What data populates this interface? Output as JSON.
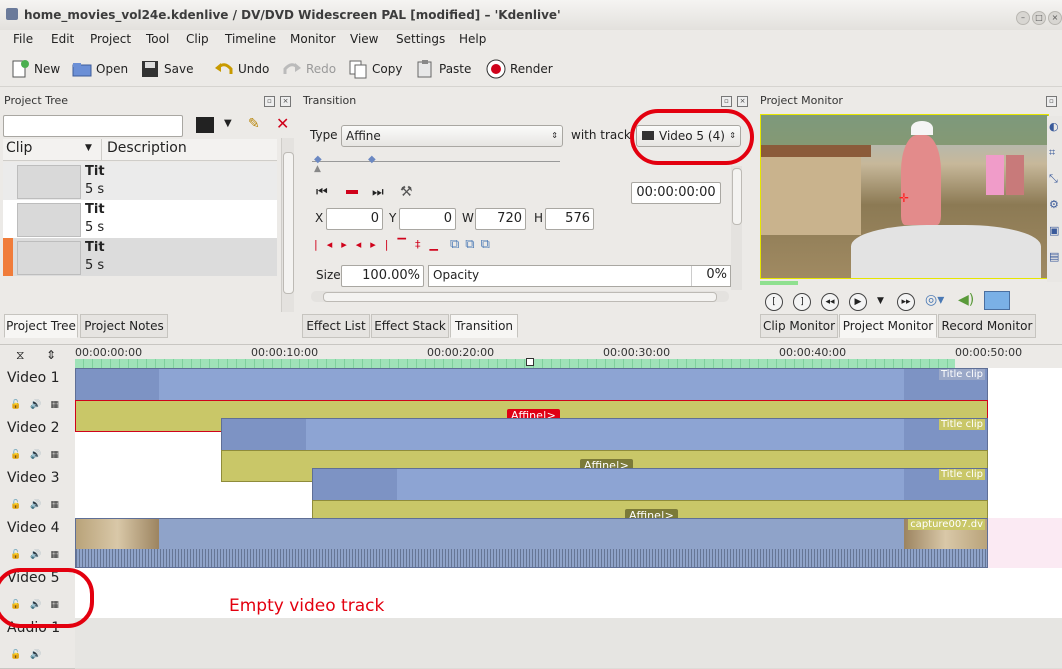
{
  "window": {
    "title": "home_movies_vol24e.kdenlive / DV/DVD Widescreen PAL [modified] – 'Kdenlive'"
  },
  "menu": [
    "File",
    "Edit",
    "Project",
    "Tool",
    "Clip",
    "Timeline",
    "Monitor",
    "View",
    "Settings",
    "Help"
  ],
  "toolbar": {
    "new": "New",
    "open": "Open",
    "save": "Save",
    "undo": "Undo",
    "redo": "Redo",
    "copy": "Copy",
    "paste": "Paste",
    "render": "Render"
  },
  "project_tree": {
    "title": "Project Tree",
    "col_clip": "Clip",
    "col_description": "Description",
    "items": [
      {
        "name": "Tit",
        "duration": "5 s"
      },
      {
        "name": "Tit",
        "duration": "5 s"
      },
      {
        "name": "Tit",
        "duration": "5 s"
      }
    ],
    "tabs": [
      "Project Tree",
      "Project Notes"
    ]
  },
  "transition": {
    "title": "Transition",
    "type_label": "Type",
    "type_value": "Affine",
    "with_track_label": "with track",
    "track_value": "Video 5 (4)",
    "timecode": "00:00:00:00",
    "x_label": "X",
    "x_value": "0",
    "y_label": "Y",
    "y_value": "0",
    "w_label": "W",
    "w_value": "720",
    "h_label": "H",
    "h_value": "576",
    "size_label": "Size",
    "size_value": "100.00%",
    "opacity_label": "Opacity",
    "opacity_value": "0%",
    "tabs": [
      "Effect List",
      "Effect Stack",
      "Transition"
    ]
  },
  "monitor": {
    "title": "Project Monitor",
    "tabs": [
      "Clip Monitor",
      "Project Monitor",
      "Record Monitor"
    ]
  },
  "timeline": {
    "ruler": [
      "00:00:00:00",
      "00:00:10:00",
      "00:00:20:00",
      "00:00:30:00",
      "00:00:40:00",
      "00:00:50:00"
    ],
    "tracks": [
      "Video 1",
      "Video 2",
      "Video 3",
      "Video 4",
      "Video 5",
      "Audio 1"
    ],
    "clip_labels": {
      "title_clip": "Title clip",
      "capture": "capture007.dv"
    },
    "transition_label": "Affine|>",
    "annotation": "Empty video track"
  },
  "colors": {
    "annotation_red": "#e3000f",
    "clip_blue": "#8da4d3",
    "transition_yellow": "#c9c768"
  }
}
